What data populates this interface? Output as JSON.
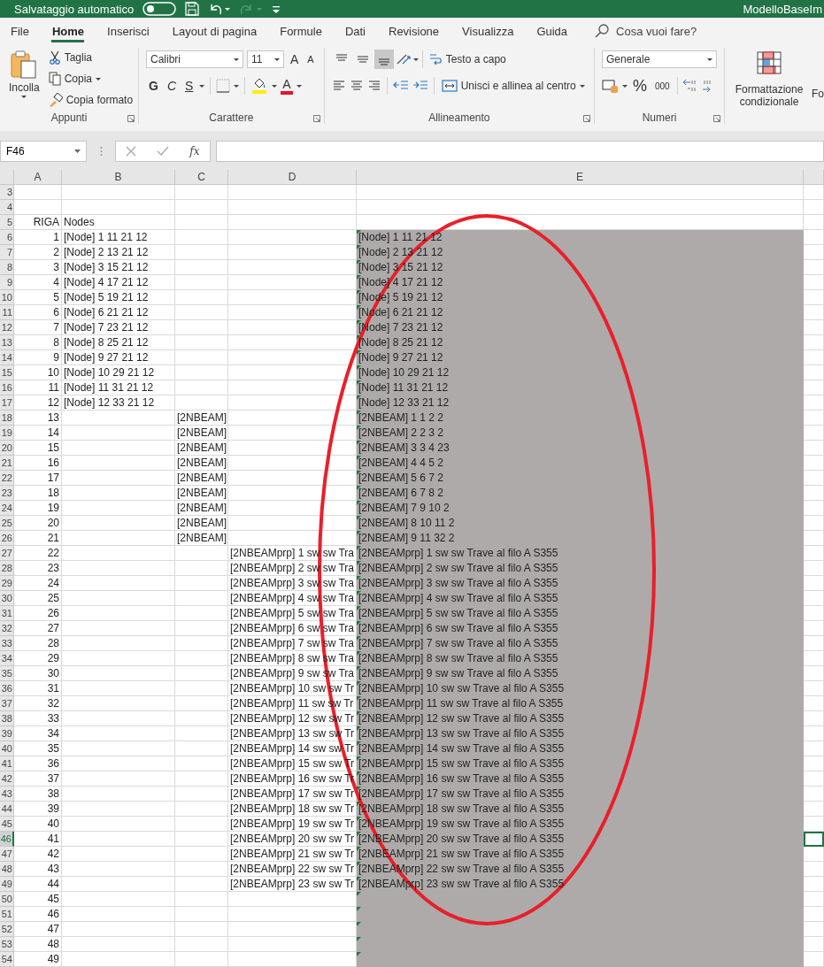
{
  "title_bar": {
    "autosave_label": "Salvataggio automatico",
    "autosave_on": false,
    "redo_disabled": true,
    "document_title": "ModelloBaseIm"
  },
  "ribbon_tabs": [
    {
      "label": "File",
      "selected": false
    },
    {
      "label": "Home",
      "selected": true
    },
    {
      "label": "Inserisci",
      "selected": false
    },
    {
      "label": "Layout di pagina",
      "selected": false
    },
    {
      "label": "Formule",
      "selected": false
    },
    {
      "label": "Dati",
      "selected": false
    },
    {
      "label": "Revisione",
      "selected": false
    },
    {
      "label": "Visualizza",
      "selected": false
    },
    {
      "label": "Guida",
      "selected": false
    }
  ],
  "tell_me": {
    "placeholder": "Cosa vuoi fare?"
  },
  "clipboard": {
    "paste": "Incolla",
    "cut": "Taglia",
    "copy": "Copia",
    "format_painter": "Copia formato",
    "label": "Appunti"
  },
  "font": {
    "name": "Calibri",
    "size": "11",
    "grow": "A",
    "shrink": "A",
    "bold": "G",
    "italic": "C",
    "underline": "S",
    "font_color": "A",
    "label": "Carattere"
  },
  "alignment": {
    "vertical": [
      {
        "kind": "top",
        "selected": false
      },
      {
        "kind": "middle",
        "selected": false
      },
      {
        "kind": "bottom",
        "selected": true
      }
    ],
    "wrap_text": "Testo a capo",
    "merge": "Unisci e allinea al centro",
    "label": "Allineamento"
  },
  "number": {
    "format": "Generale",
    "percent": "%",
    "thousands": "000",
    "label": "Numeri"
  },
  "styles": {
    "conditional": "Formattazione condizionale",
    "next": "Fo"
  },
  "formula_bar": {
    "name_box": "F46",
    "function_label": "fx"
  },
  "columns": [
    "A",
    "B",
    "C",
    "D",
    "E"
  ],
  "annotation": {
    "kind": "ellipse"
  },
  "rows": [
    {
      "n": "3",
      "selected": false,
      "shaded": false,
      "flagged": false
    },
    {
      "n": "4",
      "selected": false,
      "shaded": false,
      "flagged": false
    },
    {
      "n": "5",
      "a": "RIGA",
      "b": "Nodes",
      "selected": false,
      "shaded": false,
      "flagged": false
    },
    {
      "n": "6",
      "a": "1",
      "b": "[Node] 1 11 21 12",
      "e": "[Node] 1 11 21 12",
      "selected": false,
      "shaded": true,
      "flagged": true
    },
    {
      "n": "7",
      "a": "2",
      "b": "[Node] 2 13 21 12",
      "e": "[Node] 2 13 21 12",
      "selected": false,
      "shaded": true,
      "flagged": true
    },
    {
      "n": "8",
      "a": "3",
      "b": "[Node] 3 15 21 12",
      "e": "[Node] 3 15 21 12",
      "selected": false,
      "shaded": true,
      "flagged": true
    },
    {
      "n": "9",
      "a": "4",
      "b": "[Node] 4 17 21 12",
      "e": "[Node] 4 17 21 12",
      "selected": false,
      "shaded": true,
      "flagged": true
    },
    {
      "n": "10",
      "a": "5",
      "b": "[Node] 5 19 21 12",
      "e": "[Node] 5 19 21 12",
      "selected": false,
      "shaded": true,
      "flagged": true
    },
    {
      "n": "11",
      "a": "6",
      "b": "[Node] 6 21 21 12",
      "e": "[Node] 6 21 21 12",
      "selected": false,
      "shaded": true,
      "flagged": true
    },
    {
      "n": "12",
      "a": "7",
      "b": "[Node] 7 23 21 12",
      "e": "[Node] 7 23 21 12",
      "selected": false,
      "shaded": true,
      "flagged": true
    },
    {
      "n": "13",
      "a": "8",
      "b": "[Node] 8 25 21 12",
      "e": "[Node] 8 25 21 12",
      "selected": false,
      "shaded": true,
      "flagged": true
    },
    {
      "n": "14",
      "a": "9",
      "b": "[Node] 9 27 21 12",
      "e": "[Node] 9 27 21 12",
      "selected": false,
      "shaded": true,
      "flagged": true
    },
    {
      "n": "15",
      "a": "10",
      "b": "[Node] 10 29 21 12",
      "e": "[Node] 10 29 21 12",
      "selected": false,
      "shaded": true,
      "flagged": true
    },
    {
      "n": "16",
      "a": "11",
      "b": "[Node] 11 31 21 12",
      "e": "[Node] 11 31 21 12",
      "selected": false,
      "shaded": true,
      "flagged": true
    },
    {
      "n": "17",
      "a": "12",
      "b": "[Node] 12 33 21 12",
      "e": "[Node] 12 33 21 12",
      "selected": false,
      "shaded": true,
      "flagged": true
    },
    {
      "n": "18",
      "a": "13",
      "c": "[2NBEAM]",
      "e": "[2NBEAM] 1 1 2 2",
      "selected": false,
      "shaded": true,
      "flagged": true
    },
    {
      "n": "19",
      "a": "14",
      "c": "[2NBEAM]",
      "e": "[2NBEAM] 2 2 3 2",
      "selected": false,
      "shaded": true,
      "flagged": true
    },
    {
      "n": "20",
      "a": "15",
      "c": "[2NBEAM]",
      "e": "[2NBEAM] 3 3 4 23",
      "selected": false,
      "shaded": true,
      "flagged": true
    },
    {
      "n": "21",
      "a": "16",
      "c": "[2NBEAM]",
      "e": "[2NBEAM] 4 4 5 2",
      "selected": false,
      "shaded": true,
      "flagged": true
    },
    {
      "n": "22",
      "a": "17",
      "c": "[2NBEAM]",
      "e": "[2NBEAM] 5 6 7 2",
      "selected": false,
      "shaded": true,
      "flagged": true
    },
    {
      "n": "23",
      "a": "18",
      "c": "[2NBEAM]",
      "e": "[2NBEAM] 6 7 8 2",
      "selected": false,
      "shaded": true,
      "flagged": true
    },
    {
      "n": "24",
      "a": "19",
      "c": "[2NBEAM]",
      "e": "[2NBEAM] 7 9 10 2",
      "selected": false,
      "shaded": true,
      "flagged": true
    },
    {
      "n": "25",
      "a": "20",
      "c": "[2NBEAM]",
      "e": "[2NBEAM] 8 10 11 2",
      "selected": false,
      "shaded": true,
      "flagged": true
    },
    {
      "n": "26",
      "a": "21",
      "c": "[2NBEAM]",
      "e": "[2NBEAM] 9 11 32 2",
      "selected": false,
      "shaded": true,
      "flagged": true
    },
    {
      "n": "27",
      "a": "22",
      "d": "[2NBEAMprp] 1 sw sw Tra",
      "e": "[2NBEAMprp] 1 sw sw Trave al filo A S355",
      "selected": false,
      "shaded": true,
      "flagged": true
    },
    {
      "n": "28",
      "a": "23",
      "d": "[2NBEAMprp] 2 sw sw Tra",
      "e": "[2NBEAMprp] 2 sw sw Trave al filo A S355",
      "selected": false,
      "shaded": true,
      "flagged": true
    },
    {
      "n": "29",
      "a": "24",
      "d": "[2NBEAMprp] 3 sw sw Tra",
      "e": "[2NBEAMprp] 3 sw sw Trave al filo A S355",
      "selected": false,
      "shaded": true,
      "flagged": true
    },
    {
      "n": "30",
      "a": "25",
      "d": "[2NBEAMprp] 4 sw sw Tra",
      "e": "[2NBEAMprp] 4 sw sw Trave al filo A S355",
      "selected": false,
      "shaded": true,
      "flagged": true
    },
    {
      "n": "31",
      "a": "26",
      "d": "[2NBEAMprp] 5 sw sw Tra",
      "e": "[2NBEAMprp] 5 sw sw Trave al filo A S355",
      "selected": false,
      "shaded": true,
      "flagged": true
    },
    {
      "n": "32",
      "a": "27",
      "d": "[2NBEAMprp] 6 sw sw Tra",
      "e": "[2NBEAMprp] 6 sw sw Trave al filo A S355",
      "selected": false,
      "shaded": true,
      "flagged": true
    },
    {
      "n": "33",
      "a": "28",
      "d": "[2NBEAMprp] 7 sw sw Tra",
      "e": "[2NBEAMprp] 7 sw sw Trave al filo A S355",
      "selected": false,
      "shaded": true,
      "flagged": true
    },
    {
      "n": "34",
      "a": "29",
      "d": "[2NBEAMprp] 8 sw sw Tra",
      "e": "[2NBEAMprp] 8 sw sw Trave al filo A S355",
      "selected": false,
      "shaded": true,
      "flagged": true
    },
    {
      "n": "35",
      "a": "30",
      "d": "[2NBEAMprp] 9 sw sw Tra",
      "e": "[2NBEAMprp] 9 sw sw Trave al filo A S355",
      "selected": false,
      "shaded": true,
      "flagged": true
    },
    {
      "n": "36",
      "a": "31",
      "d": "[2NBEAMprp] 10 sw sw Tr",
      "e": "[2NBEAMprp] 10 sw sw Trave al filo A S355",
      "selected": false,
      "shaded": true,
      "flagged": true
    },
    {
      "n": "37",
      "a": "32",
      "d": "[2NBEAMprp] 11 sw sw Tr",
      "e": "[2NBEAMprp] 11 sw sw Trave al filo A S355",
      "selected": false,
      "shaded": true,
      "flagged": true
    },
    {
      "n": "38",
      "a": "33",
      "d": "[2NBEAMprp] 12 sw sw Tr",
      "e": "[2NBEAMprp] 12 sw sw Trave al filo A S355",
      "selected": false,
      "shaded": true,
      "flagged": true
    },
    {
      "n": "39",
      "a": "34",
      "d": "[2NBEAMprp] 13 sw sw Tr",
      "e": "[2NBEAMprp] 13 sw sw Trave al filo A S355",
      "selected": false,
      "shaded": true,
      "flagged": true
    },
    {
      "n": "40",
      "a": "35",
      "d": "[2NBEAMprp] 14 sw sw Tr",
      "e": "[2NBEAMprp] 14 sw sw Trave al filo A S355",
      "selected": false,
      "shaded": true,
      "flagged": true
    },
    {
      "n": "41",
      "a": "36",
      "d": "[2NBEAMprp] 15 sw sw Tr",
      "e": "[2NBEAMprp] 15 sw sw Trave al filo A S355",
      "selected": false,
      "shaded": true,
      "flagged": true
    },
    {
      "n": "42",
      "a": "37",
      "d": "[2NBEAMprp] 16 sw sw Tr",
      "e": "[2NBEAMprp] 16 sw sw Trave al filo A S355",
      "selected": false,
      "shaded": true,
      "flagged": true
    },
    {
      "n": "43",
      "a": "38",
      "d": "[2NBEAMprp] 17 sw sw Tr",
      "e": "[2NBEAMprp] 17 sw sw Trave al filo A S355",
      "selected": false,
      "shaded": true,
      "flagged": true
    },
    {
      "n": "44",
      "a": "39",
      "d": "[2NBEAMprp] 18 sw sw Tr",
      "e": "[2NBEAMprp] 18 sw sw Trave al filo A S355",
      "selected": false,
      "shaded": true,
      "flagged": true
    },
    {
      "n": "45",
      "a": "40",
      "d": "[2NBEAMprp] 19 sw sw Tr",
      "e": "[2NBEAMprp] 19 sw sw Trave al filo A S355",
      "selected": false,
      "shaded": true,
      "flagged": true
    },
    {
      "n": "46",
      "a": "41",
      "d": "[2NBEAMprp] 20 sw sw Tr",
      "e": "[2NBEAMprp] 20 sw sw Trave al filo A S355",
      "selected": true,
      "shaded": true,
      "flagged": true
    },
    {
      "n": "47",
      "a": "42",
      "d": "[2NBEAMprp] 21 sw sw Tr",
      "e": "[2NBEAMprp] 21 sw sw Trave al filo A S355",
      "selected": false,
      "shaded": true,
      "flagged": true
    },
    {
      "n": "48",
      "a": "43",
      "d": "[2NBEAMprp] 22 sw sw Tr",
      "e": "[2NBEAMprp] 22 sw sw Trave al filo A S355",
      "selected": false,
      "shaded": true,
      "flagged": true
    },
    {
      "n": "49",
      "a": "44",
      "d": "[2NBEAMprp] 23 sw sw Tr",
      "e": "[2NBEAMprp] 23 sw sw Trave al filo A S355",
      "selected": false,
      "shaded": true,
      "flagged": true
    },
    {
      "n": "50",
      "a": "45",
      "selected": false,
      "shaded": true,
      "flagged": true
    },
    {
      "n": "51",
      "a": "46",
      "selected": false,
      "shaded": true,
      "flagged": true
    },
    {
      "n": "52",
      "a": "47",
      "selected": false,
      "shaded": true,
      "flagged": true
    },
    {
      "n": "53",
      "a": "48",
      "selected": false,
      "shaded": true,
      "flagged": true
    },
    {
      "n": "54",
      "a": "49",
      "selected": false,
      "shaded": true,
      "flagged": true
    }
  ]
}
